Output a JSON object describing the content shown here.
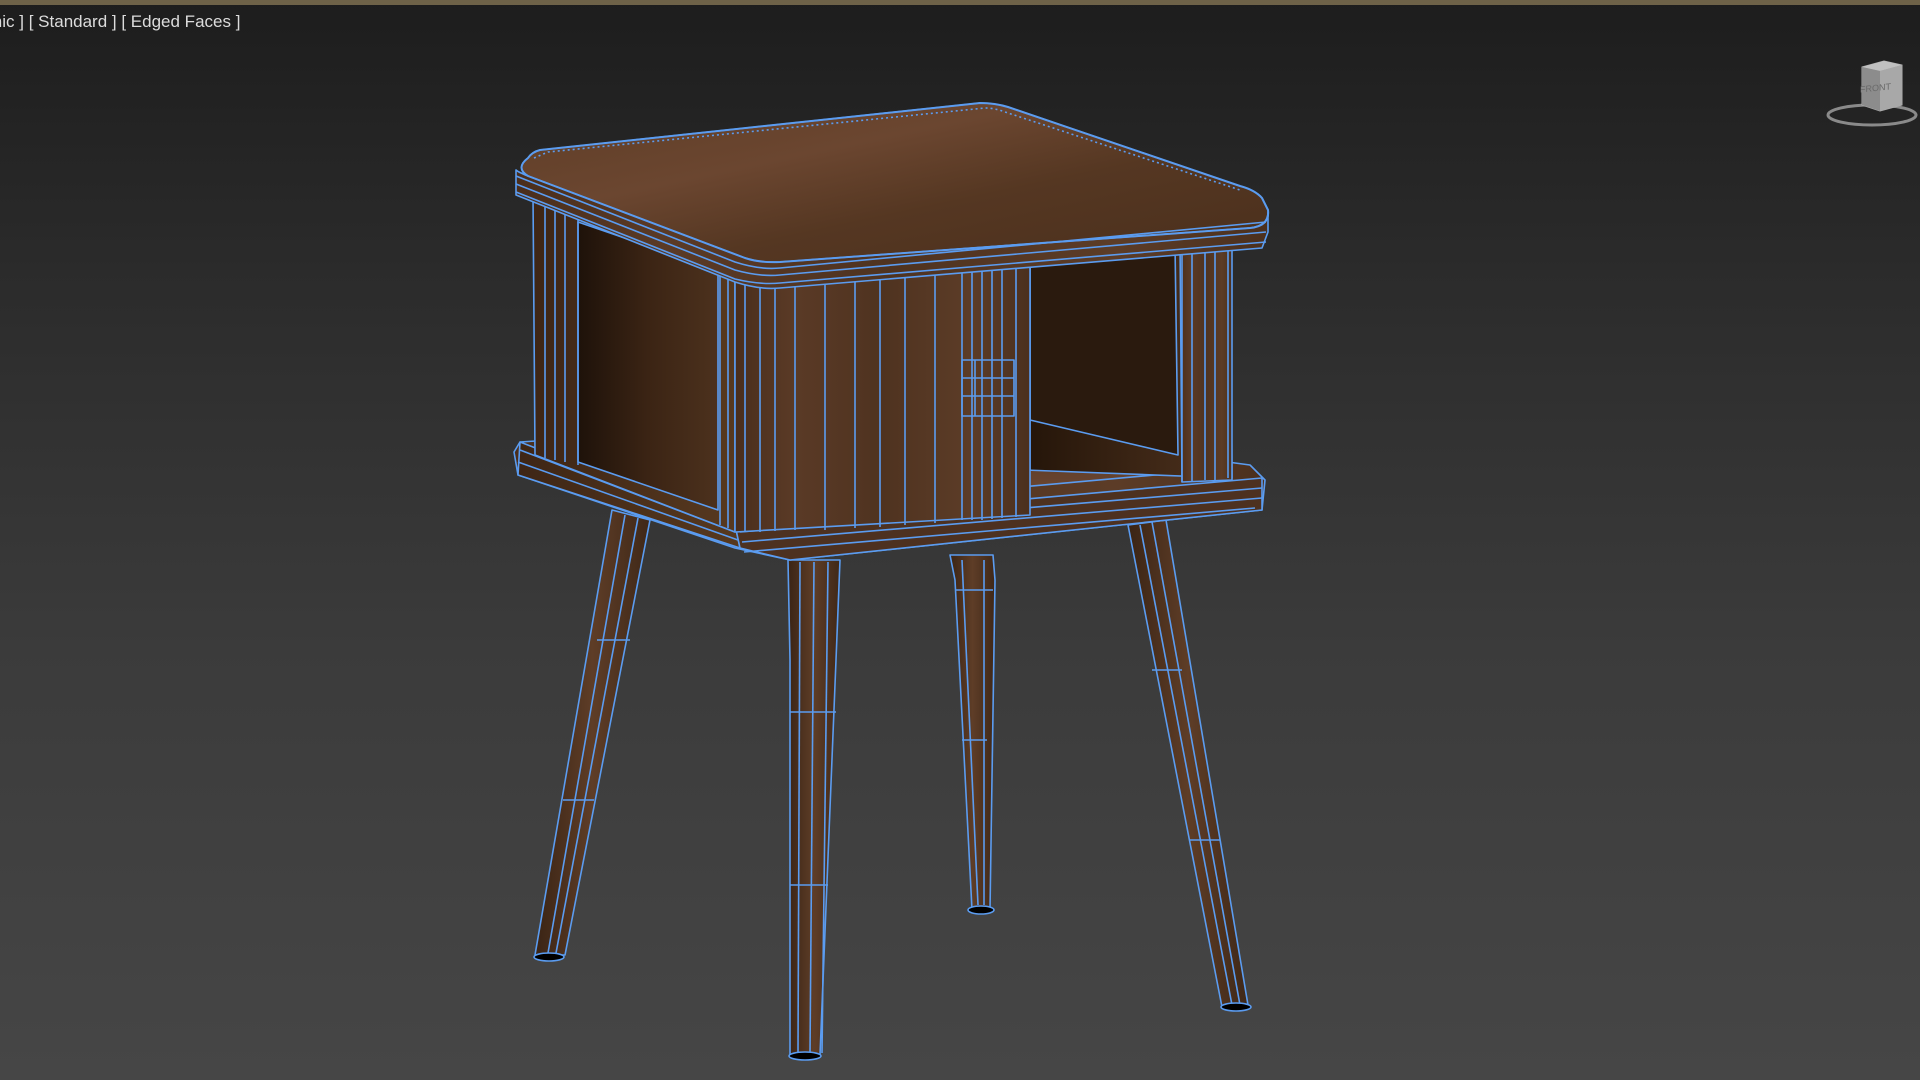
{
  "viewport": {
    "labels": {
      "view": "[ Orthographic ]",
      "shading": "[ Standard ]",
      "display": "[ Edged Faces ]"
    },
    "viewcube": {
      "face": "FRONT"
    },
    "scene": {
      "object": "nightstand",
      "wire_color": "#5b9cf0",
      "wood_color": "#5c3b24",
      "background_top": "#1d1d1d",
      "background_bottom": "#464646"
    }
  }
}
